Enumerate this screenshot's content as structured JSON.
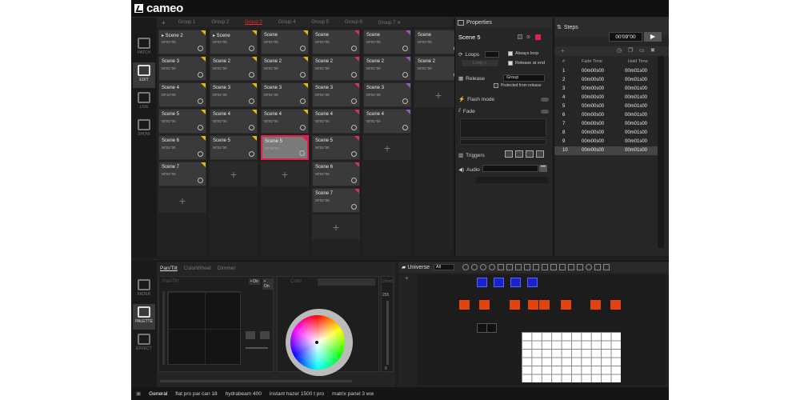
{
  "app": {
    "logo": "cameo"
  },
  "nav_top": [
    {
      "label": "PATCH",
      "active": false
    },
    {
      "label": "EDIT",
      "active": true
    },
    {
      "label": "LIVE",
      "active": false
    },
    {
      "label": "SHOW",
      "active": false
    }
  ],
  "nav_bottom": [
    {
      "label": "FADER",
      "active": false
    },
    {
      "label": "PALETTE",
      "active": true
    },
    {
      "label": "EFFECT",
      "active": false
    }
  ],
  "group_tabs": [
    "Group 1",
    "Group 2",
    "Group 3",
    "Group 4",
    "Group 5",
    "Group 6",
    "Group 7 ✕"
  ],
  "active_group": "Group 3",
  "add_tab": "+",
  "columns": [
    {
      "scenes": [
        {
          "name": "▸ Scene 2",
          "time": "00'01\"00",
          "color": "#e8b800"
        },
        {
          "name": "Scene 3",
          "time": "00'01\"00",
          "color": "#e8b800"
        },
        {
          "name": "Scene 4",
          "time": "00'10\"00",
          "color": "#e8b800"
        },
        {
          "name": "Scene 5",
          "time": "00'01\"00",
          "color": "#e8b800"
        },
        {
          "name": "Scene 6",
          "time": "00'01\"00",
          "color": "#e8b800"
        },
        {
          "name": "Scene 7",
          "time": "00'01\"00",
          "color": "#e8b800"
        }
      ]
    },
    {
      "scenes": [
        {
          "name": "▸ Scene",
          "time": "00'01\"00",
          "color": "#e8b800"
        },
        {
          "name": "Scene 2",
          "time": "00'01\"00",
          "color": "#e8b800"
        },
        {
          "name": "Scene 3",
          "time": "00'01\"00",
          "color": "#e8b800"
        },
        {
          "name": "Scene 4",
          "time": "00'01\"00",
          "color": "#e8b800"
        },
        {
          "name": "Scene 5",
          "time": "00'01\"00",
          "color": "#e8b800"
        }
      ]
    },
    {
      "scenes": [
        {
          "name": "Scene",
          "time": "00'01\"00",
          "color": "#e8b800"
        },
        {
          "name": "Scene 2",
          "time": "00'01\"00",
          "color": "#e8b800"
        },
        {
          "name": "Scene 3",
          "time": "00'01\"00",
          "color": "#e8b800"
        },
        {
          "name": "Scene 4",
          "time": "00'01\"00",
          "color": "#e8b800"
        },
        {
          "name": "Scene 5",
          "time": "00'10\"00",
          "color": "#e2204a",
          "selected": true
        }
      ]
    },
    {
      "scenes": [
        {
          "name": "Scene",
          "time": "00'01\"00",
          "color": "#d0307a"
        },
        {
          "name": "Scene 2",
          "time": "00'01\"00",
          "color": "#d0307a"
        },
        {
          "name": "Scene 3",
          "time": "00'01\"00",
          "color": "#d0307a"
        },
        {
          "name": "Scene 4",
          "time": "00'01\"00",
          "color": "#d0307a"
        },
        {
          "name": "Scene 5",
          "time": "00'01\"00",
          "color": "#d0307a"
        },
        {
          "name": "Scene 6",
          "time": "00'01\"00",
          "color": "#d0307a"
        },
        {
          "name": "Scene 7",
          "time": "00'01\"00",
          "color": "#d0307a"
        }
      ]
    },
    {
      "scenes": [
        {
          "name": "Scene",
          "time": "00'01\"00",
          "color": "#9955cc"
        },
        {
          "name": "Scene 2",
          "time": "00'01\"00",
          "color": "#9955cc"
        },
        {
          "name": "Scene 3",
          "time": "00'01\"00",
          "color": "#9955cc"
        },
        {
          "name": "Scene 4",
          "time": "00'01\"50",
          "color": "#9955cc"
        }
      ]
    },
    {
      "scenes": [
        {
          "name": "Scene",
          "time": "00'01\"00",
          "color": "#9955cc"
        },
        {
          "name": "Scene 2",
          "time": "00'01\"00",
          "color": "#9955cc"
        }
      ]
    }
  ],
  "properties": {
    "title": "Properties",
    "scene_name": "Scene 5",
    "loops_label": "Loops",
    "always_loop": "Always loop",
    "release_at_end": "Release at end",
    "loop_btn": "Loop ∞",
    "release_label": "Release",
    "release_value": "Group",
    "protected": "Protected from release",
    "flash_label": "Flash mode",
    "fade_label": "Fade",
    "triggers_label": "Triggers",
    "audio_label": "Audio"
  },
  "steps": {
    "title": "Steps",
    "time": "00'09\"00",
    "headers": [
      "#",
      "Fade Time",
      "Hold Time"
    ],
    "rows": [
      [
        "1",
        "00m00s00",
        "00m01s00"
      ],
      [
        "2",
        "00m00s00",
        "00m01s00"
      ],
      [
        "3",
        "00m00s00",
        "00m01s00"
      ],
      [
        "4",
        "00m00s00",
        "00m01s00"
      ],
      [
        "5",
        "00m00s00",
        "00m01s00"
      ],
      [
        "6",
        "00m00s00",
        "00m01s00"
      ],
      [
        "7",
        "00m00s00",
        "00m01s00"
      ],
      [
        "8",
        "00m00s00",
        "00m01s00"
      ],
      [
        "9",
        "00m00s00",
        "00m01s00"
      ],
      [
        "10",
        "00m00s00",
        "00m01s00"
      ]
    ]
  },
  "palette": {
    "tabs": [
      "Pan/Tilt",
      "ColorWheel",
      "Dimmer"
    ],
    "pan_tilt_label": "Pan/Tilt",
    "color_label": "Color",
    "dimmer_label": "Dimm",
    "on_label": "• On",
    "dimmer_max": "255",
    "dimmer_min": "0"
  },
  "universe": {
    "label": "Universe",
    "select": "All"
  },
  "status": {
    "items": [
      "General",
      "flat pro par can 18",
      "hydrabeam 400",
      "instant hazer 1500 t pro",
      "matrix panel 3 ww"
    ]
  },
  "colors": {
    "accent": "#e2204a",
    "blue": "#1a22cc",
    "orange": "#e2430f"
  }
}
